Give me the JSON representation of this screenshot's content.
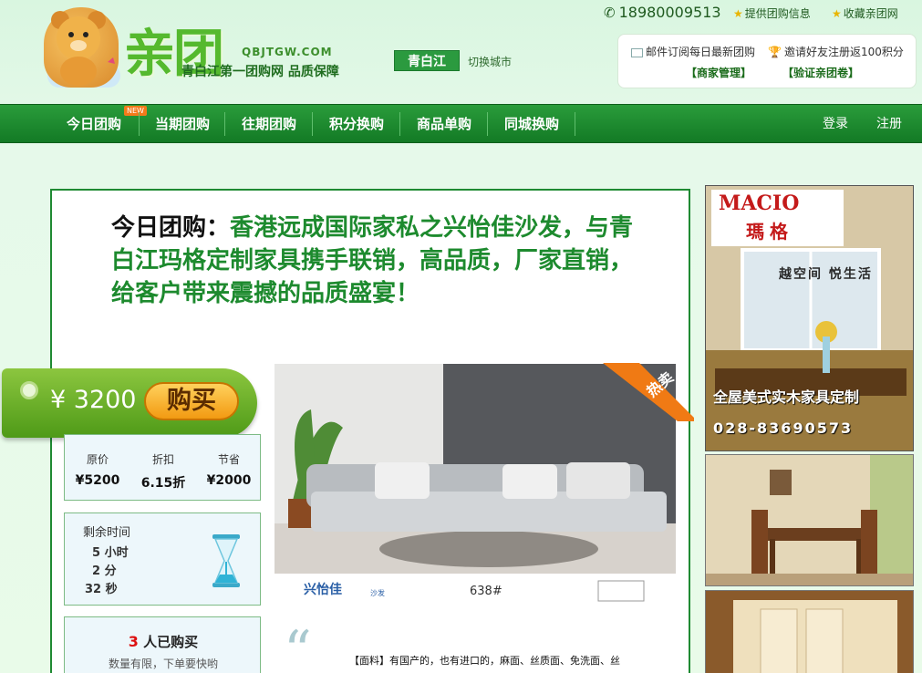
{
  "header": {
    "logo_text": "亲团",
    "logo_domain": "QBJTGW.COM",
    "slogan": "青白江第一团购网 品质保障",
    "city": "青白江",
    "switch_city": "切换城市",
    "phone": "18980009513",
    "link_provide": "提供团购信息",
    "link_favorite": "收藏亲团网",
    "subscribe": "邮件订阅每日最新团购",
    "invite": "邀请好友注册返100积分",
    "merchant": "【商家管理】",
    "verify": "【验证亲团卷】"
  },
  "nav": {
    "items": [
      "今日团购",
      "当期团购",
      "往期团购",
      "积分换购",
      "商品单购",
      "同城换购"
    ],
    "new_badge": "NEW",
    "login": "登录",
    "register": "注册"
  },
  "deal": {
    "title_lead": "今日团购：",
    "title_body": "香港远成国际家私之兴怡佳沙发，与青白江玛格定制家具携手联销，高品质，厂家直销，给客户带来震撼的品质盛宴！",
    "price": "¥ 3200",
    "buy_label": "购买",
    "orig_label": "原价",
    "discount_label": "折扣",
    "save_label": "节省",
    "orig": "¥5200",
    "discount": "6.15折",
    "save": "¥2000",
    "remain_label": "剩余时间",
    "hours": "5 小时",
    "minutes": "2 分",
    "seconds": "32 秒",
    "bought_count": "3",
    "bought_label": "人已购买",
    "limited": "数量有限，下单要快哟",
    "hot_badge": "热卖",
    "brand": "兴怡佳",
    "brand_sub": "沙发",
    "model": "638#",
    "desc": "【面料】有国产的，也有进口的，麻面、丝质面、免洗面、丝"
  },
  "ads": {
    "ad1_brand_en": "MACIO",
    "ad1_brand_cn": "瑪格",
    "ad1_slogan": "越空间 悦生活",
    "ad1_line": "全屋美式实木家具定制",
    "ad1_phone": "028-83690573"
  },
  "colors": {
    "brand_green": "#1f8a33",
    "nav_green": "#1e8b31",
    "price_green": "#6bb22a",
    "buy_orange": "#f5a623"
  }
}
